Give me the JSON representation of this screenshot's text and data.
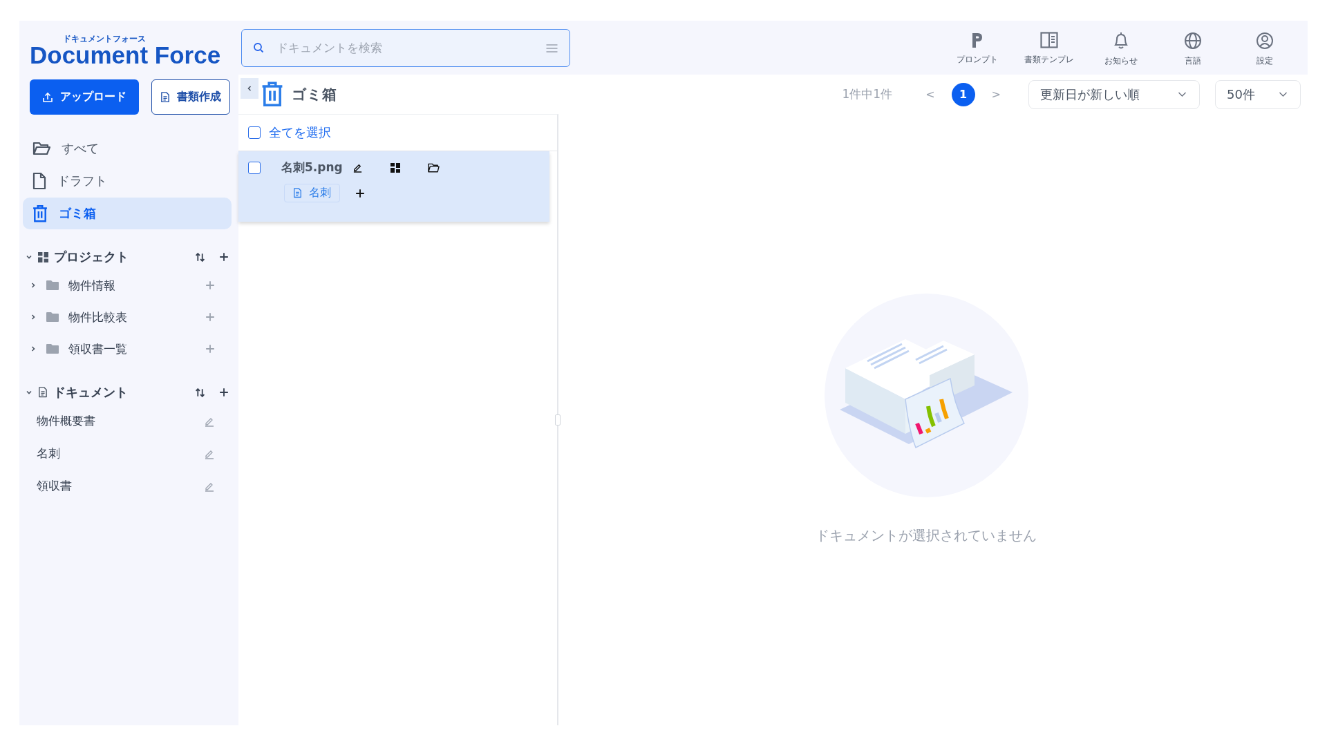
{
  "logo": {
    "kana": "ドキュメントフォース",
    "name": "Document Force"
  },
  "search": {
    "placeholder": "ドキュメントを検索"
  },
  "toolbar": [
    {
      "label": "プロンプト"
    },
    {
      "label": "書類テンプレ"
    },
    {
      "label": "お知らせ"
    },
    {
      "label": "言語"
    },
    {
      "label": "設定"
    }
  ],
  "sidebar": {
    "buttons": [
      {
        "label": "アップロード",
        "kind": "primary"
      },
      {
        "label": "書類作成",
        "kind": "secondary"
      }
    ],
    "nav": [
      {
        "label": "すべて",
        "selected": false
      },
      {
        "label": "ドラフト",
        "selected": false
      },
      {
        "label": "ゴミ箱",
        "selected": true
      }
    ],
    "sections": [
      {
        "title": "プロジェクト",
        "kind": "project",
        "expanded": true,
        "items": [
          {
            "label": "物件情報",
            "expanded": false
          },
          {
            "label": "物件比較表",
            "expanded": false
          },
          {
            "label": "領収書一覧",
            "expanded": false
          }
        ]
      },
      {
        "title": "ドキュメント",
        "kind": "document",
        "expanded": true,
        "items": [
          {
            "label": "物件概要書"
          },
          {
            "label": "名刺"
          },
          {
            "label": "領収書"
          }
        ]
      }
    ]
  },
  "content": {
    "title": "ゴミ箱",
    "pagination": {
      "summary": "1件中1件",
      "prev": "<",
      "next": ">",
      "pages": [
        {
          "label": "1",
          "selected": true
        }
      ]
    },
    "sort": "更新日が新しい順",
    "per_page": "50件",
    "select_all": {
      "label": "全てを選択",
      "checked": false
    },
    "files": [
      {
        "name": "名刺5.png",
        "checked": false,
        "selected": true,
        "tag": "名刺"
      }
    ],
    "empty_message": "ドキュメントが選択されていません"
  }
}
